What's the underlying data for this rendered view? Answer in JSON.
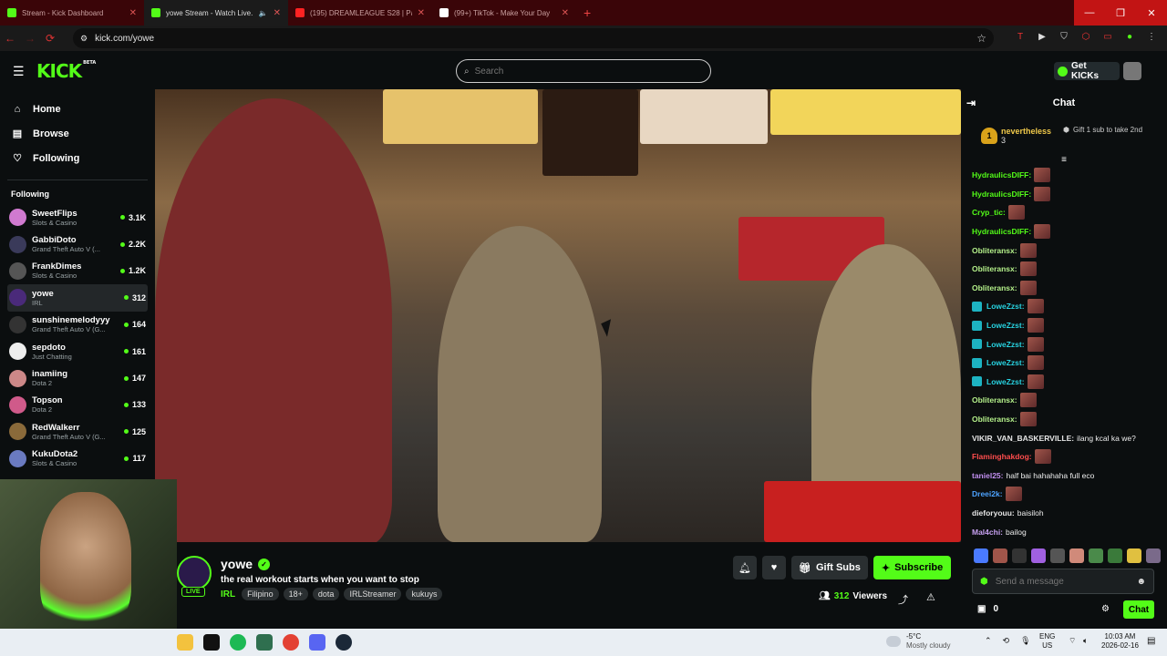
{
  "browser": {
    "tabs": [
      {
        "title": "Stream - Kick Dashboard",
        "favicon_color": "#53fc18"
      },
      {
        "title": "yowe Stream - Watch Live...",
        "favicon_color": "#53fc18",
        "muted_icon": "speaker-icon"
      },
      {
        "title": "(195) DREAMLEAGUE S28 | Pa...",
        "favicon_color": "#ff2222"
      },
      {
        "title": "(99+) TikTok - Make Your Day",
        "favicon_color": "#ffffff"
      }
    ],
    "new_tab_label": "+",
    "address": "kick.com/yowe",
    "window_controls": [
      "—",
      "❐",
      "✕"
    ]
  },
  "header": {
    "logo": "KICK",
    "logo_beta": "BETA",
    "search_placeholder": "Search",
    "get_kicks_label": "Get KICKs"
  },
  "sidebar": {
    "nav": [
      {
        "label": "Home",
        "icon": "home-icon",
        "glyph": "⌂"
      },
      {
        "label": "Browse",
        "icon": "browse-icon",
        "glyph": "▤"
      },
      {
        "label": "Following",
        "icon": "heart-icon",
        "glyph": "♡"
      }
    ],
    "following_heading": "Following",
    "channels": [
      {
        "name": "SweetFlips",
        "category": "Slots & Casino",
        "viewers": "3.1K",
        "color": "#d07ad0"
      },
      {
        "name": "GabbiDoto",
        "category": "Grand Theft Auto V (...",
        "viewers": "2.2K",
        "color": "#3a3a5a"
      },
      {
        "name": "FrankDimes",
        "category": "Slots & Casino",
        "viewers": "1.2K",
        "color": "#555"
      },
      {
        "name": "yowe",
        "category": "IRL",
        "viewers": "312",
        "color": "#4a2a7a",
        "active": true
      },
      {
        "name": "sunshinemelodyyy",
        "category": "Grand Theft Auto V (G...",
        "viewers": "164",
        "color": "#333"
      },
      {
        "name": "sepdoto",
        "category": "Just Chatting",
        "viewers": "161",
        "color": "#eee"
      },
      {
        "name": "inamiing",
        "category": "Dota 2",
        "viewers": "147",
        "color": "#c88"
      },
      {
        "name": "Topson",
        "category": "Dota 2",
        "viewers": "133",
        "color": "#d05a8a"
      },
      {
        "name": "RedWalkerr",
        "category": "Grand Theft Auto V (G...",
        "viewers": "125",
        "color": "#8a6a3a"
      },
      {
        "name": "KukuDota2",
        "category": "Slots & Casino",
        "viewers": "117",
        "color": "#6a7ac0"
      }
    ]
  },
  "stream": {
    "channel": "yowe",
    "live_label": "LIVE",
    "title": "the real workout starts when you want to stop",
    "category": "IRL",
    "tags": [
      "Filipino",
      "18+",
      "dota",
      "IRLStreamer",
      "kukuys"
    ],
    "gift_subs_label": "Gift Subs",
    "subscribe_label": "Subscribe",
    "viewer_count": "312",
    "viewers_label": "Viewers"
  },
  "chat": {
    "title": "Chat",
    "pinned": {
      "rank": "1",
      "name": "nevertheless",
      "count": "3",
      "gift_text": "Gift 1 sub to take 2nd"
    },
    "messages": [
      {
        "user": "HydraulicsDIFF:",
        "color": "#53fc18",
        "text": "",
        "emote": true
      },
      {
        "user": "HydraulicsDIFF:",
        "color": "#53fc18",
        "text": "",
        "emote": true
      },
      {
        "user": "Cryp_tic:",
        "color": "#53fc18",
        "text": "",
        "emote": true
      },
      {
        "user": "HydraulicsDIFF:",
        "color": "#53fc18",
        "text": "",
        "emote": true
      },
      {
        "user": "Obliteransx:",
        "color": "#b4f08a",
        "text": "",
        "emote": true
      },
      {
        "user": "Obliteransx:",
        "color": "#b4f08a",
        "text": "",
        "emote": true
      },
      {
        "user": "Obliteransx:",
        "color": "#b4f08a",
        "text": "",
        "emote": true
      },
      {
        "user": "LoweZzst:",
        "color": "#27d2e0",
        "text": "",
        "emote": true,
        "badge": true
      },
      {
        "user": "LoweZzst:",
        "color": "#27d2e0",
        "text": "",
        "emote": true,
        "badge": true
      },
      {
        "user": "LoweZzst:",
        "color": "#27d2e0",
        "text": "",
        "emote": true,
        "badge": true
      },
      {
        "user": "LoweZzst:",
        "color": "#27d2e0",
        "text": "",
        "emote": true,
        "badge": true
      },
      {
        "user": "LoweZzst:",
        "color": "#27d2e0",
        "text": "",
        "emote": true,
        "badge": true
      },
      {
        "user": "Obliteransx:",
        "color": "#b4f08a",
        "text": "",
        "emote": true
      },
      {
        "user": "Obliteransx:",
        "color": "#b4f08a",
        "text": "",
        "emote": true
      },
      {
        "user": "VIKIR_VAN_BASKERVILLE:",
        "color": "#e5e5e5",
        "text": "ilang kcal ka we?",
        "emote": false
      },
      {
        "user": "Flaminghakdog:",
        "color": "#ff4d4d",
        "text": "",
        "emote": true
      },
      {
        "user": "taniel25:",
        "color": "#c28ff0",
        "text": "half bai hahahaha full eco",
        "emote": false
      },
      {
        "user": "Dreei2k:",
        "color": "#4da3ff",
        "text": "",
        "emote": true
      },
      {
        "user": "dieforyouu:",
        "color": "#e5e5e5",
        "text": "baisiloh",
        "emote": false
      },
      {
        "user": "Mal4chi:",
        "color": "#c6a0f0",
        "text": "bailog",
        "emote": false
      }
    ],
    "input_placeholder": "Send a message",
    "points": "0",
    "send_label": "Chat"
  },
  "taskbar": {
    "weather_temp": "-5°C",
    "weather_desc": "Mostly cloudy",
    "lang1": "ENG",
    "lang2": "US",
    "time": "10:03 AM",
    "date": "2026-02-16"
  }
}
